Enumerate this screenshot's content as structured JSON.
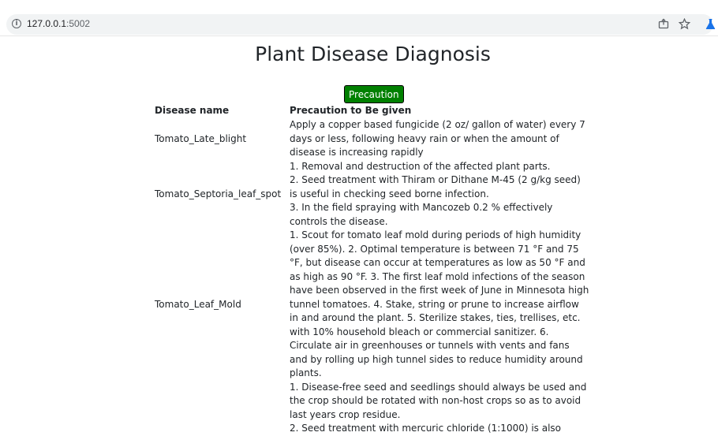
{
  "browser": {
    "info_icon": "info-icon",
    "url_host": "127.0.0.1",
    "url_port": ":5002",
    "share_icon": "share-icon",
    "star_icon": "star-icon",
    "extension_icon": "flask-icon"
  },
  "page": {
    "title": "Plant Disease Diagnosis",
    "precaution_button": "Precaution"
  },
  "table": {
    "headers": {
      "disease_name": "Disease name",
      "precaution": "Precaution to Be given"
    },
    "rows": [
      {
        "name": "Tomato_Late_blight",
        "precaution": [
          "Apply a copper based fungicide (2 oz/ gallon of water) every 7 days or less, following heavy rain or when the amount of disease is increasing rapidly"
        ]
      },
      {
        "name": "Tomato_Septoria_leaf_spot",
        "precaution": [
          "1. Removal and destruction of the affected plant parts.",
          "2. Seed treatment with Thiram or Dithane M-45 (2 g/kg seed) is useful in checking seed borne infection.",
          "3. In the field spraying with Mancozeb 0.2 % effectively controls the disease."
        ]
      },
      {
        "name": "Tomato_Leaf_Mold",
        "precaution": [
          "1. Scout for tomato leaf mold during periods of high humidity (over 85%). 2. Optimal temperature is between 71 °F and 75 °F, but disease can occur at temperatures as low as 50 °F and as high as 90 °F. 3. The first leaf mold infections of the season have been observed in the first week of June in Minnesota high tunnel tomatoes. 4. Stake, string or prune to increase airflow in and around the plant. 5. Sterilize stakes, ties, trellises, etc. with 10% household bleach or commercial sanitizer. 6. Circulate air in greenhouses or tunnels with vents and fans and by rolling up high tunnel sides to reduce humidity around plants."
        ]
      },
      {
        "name": "",
        "precaution": [
          "1. Disease-free seed and seedlings should always be used and the crop should be rotated with non-host crops so as to avoid last years crop residue.",
          "2. Seed treatment with mercuric chloride (1:1000) is also"
        ]
      }
    ]
  }
}
